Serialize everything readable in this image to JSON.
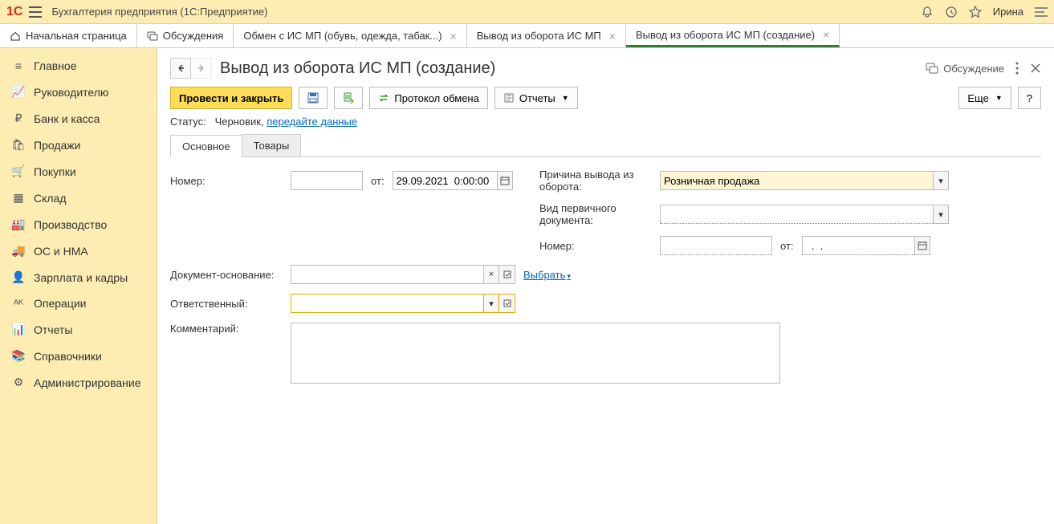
{
  "topbar": {
    "title": "Бухгалтерия предприятия  (1С:Предприятие)",
    "user": "Ирина"
  },
  "tabs": {
    "home": "Начальная страница",
    "discussions": "Обсуждения",
    "t2": "Обмен с ИС МП (обувь, одежда, табак...)",
    "t3": "Вывод из оборота ИС МП",
    "t4": "Вывод из оборота ИС МП (создание)"
  },
  "sidebar": {
    "items": [
      {
        "icon": "≡",
        "label": "Главное"
      },
      {
        "icon": "📈",
        "label": "Руководителю"
      },
      {
        "icon": "₽",
        "label": "Банк и касса"
      },
      {
        "icon": "🛍",
        "label": "Продажи"
      },
      {
        "icon": "🛒",
        "label": "Покупки"
      },
      {
        "icon": "▦",
        "label": "Склад"
      },
      {
        "icon": "🏭",
        "label": "Производство"
      },
      {
        "icon": "🚚",
        "label": "ОС и НМА"
      },
      {
        "icon": "👤",
        "label": "Зарплата и кадры"
      },
      {
        "icon": "ᴬᴷ",
        "label": "Операции"
      },
      {
        "icon": "📊",
        "label": "Отчеты"
      },
      {
        "icon": "📚",
        "label": "Справочники"
      },
      {
        "icon": "⚙",
        "label": "Администрирование"
      }
    ]
  },
  "page": {
    "title": "Вывод из оборота ИС МП (создание)",
    "discussion": "Обсуждение"
  },
  "toolbar": {
    "post_close": "Провести и закрыть",
    "protocol": "Протокол обмена",
    "reports": "Отчеты",
    "more": "Еще",
    "help": "?"
  },
  "status": {
    "label": "Статус:",
    "value": "Черновик,",
    "link": "передайте данные"
  },
  "subtabs": {
    "main": "Основное",
    "goods": "Товары"
  },
  "form": {
    "number_label": "Номер:",
    "number_value": "",
    "from_label": "от:",
    "date_value": "29.09.2021  0:00:00",
    "reason_label": "Причина вывода из оборота:",
    "reason_value": "Розничная продажа",
    "primary_doc_label": "Вид первичного документа:",
    "primary_doc_value": "",
    "number2_label": "Номер:",
    "number2_value": "",
    "from2_label": "от:",
    "date2_value": "  .  .",
    "basis_label": "Документ-основание:",
    "basis_value": "",
    "select_link": "Выбрать",
    "responsible_label": "Ответственный:",
    "responsible_value": "",
    "comment_label": "Комментарий:",
    "comment_value": ""
  }
}
